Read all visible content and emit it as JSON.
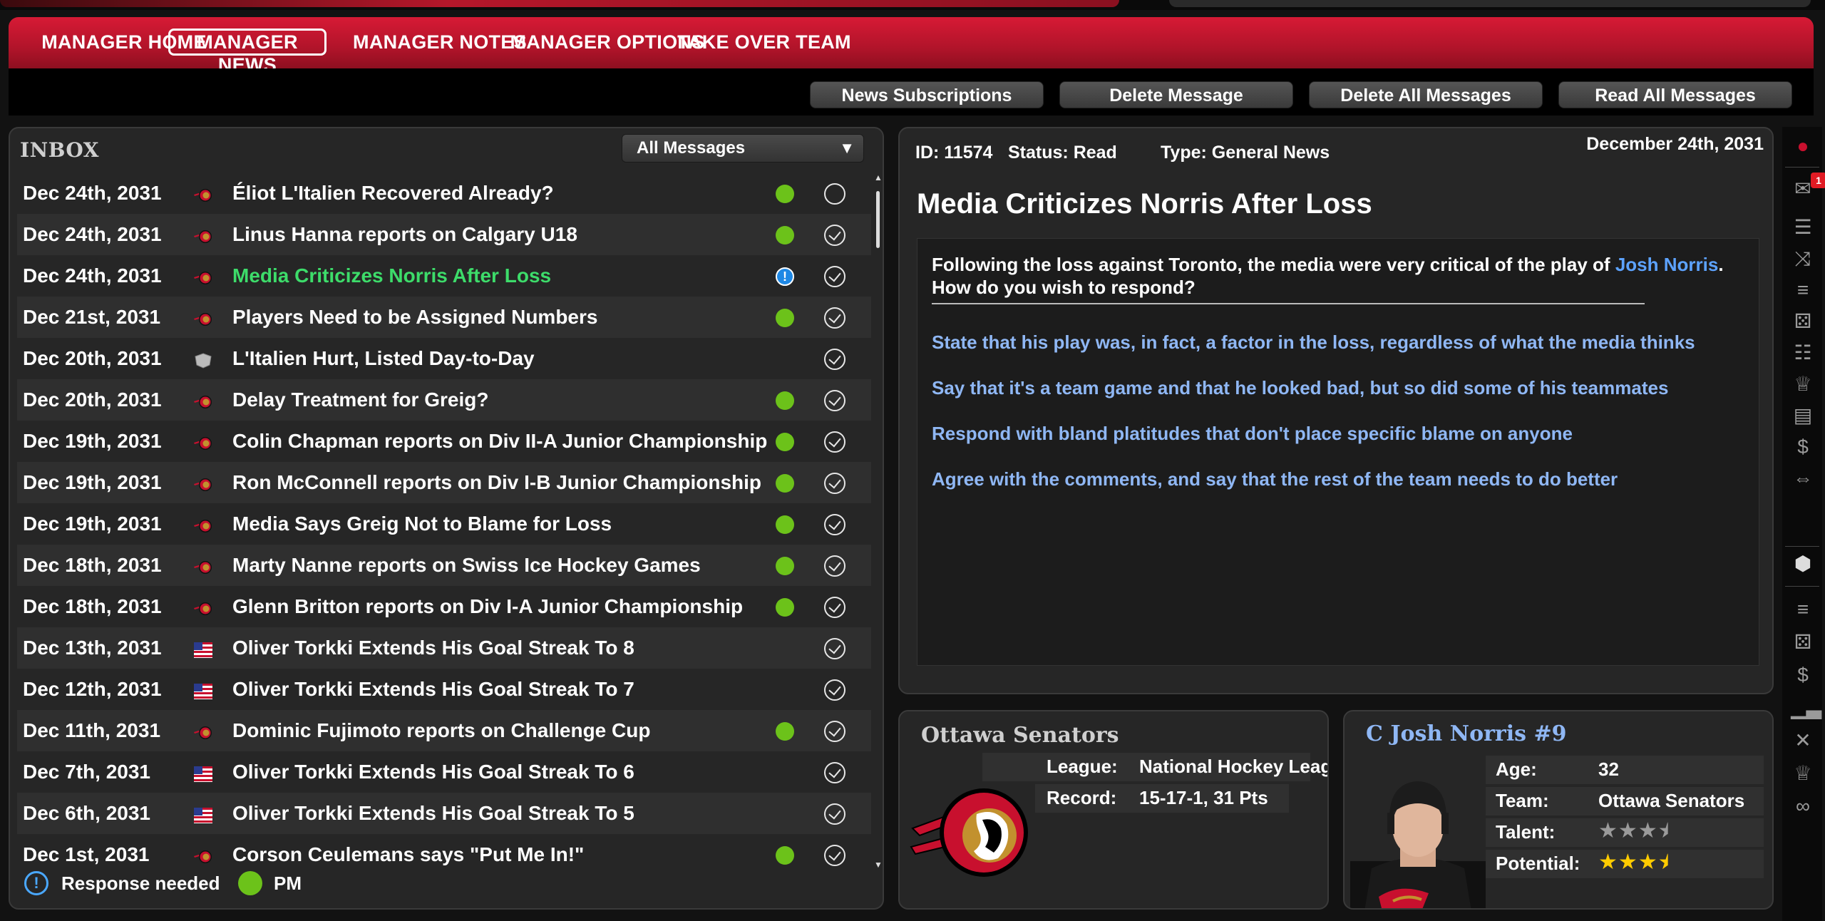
{
  "nav": {
    "items": [
      {
        "label": "MANAGER HOME"
      },
      {
        "label": "MANAGER NEWS"
      },
      {
        "label": "MANAGER NOTES"
      },
      {
        "label": "MANAGER OPTIONS"
      },
      {
        "label": "TAKE OVER TEAM"
      }
    ],
    "active_index": 1
  },
  "toolbar": {
    "news_subscriptions": "News Subscriptions",
    "delete_message": "Delete Message",
    "delete_all": "Delete All Messages",
    "read_all": "Read All Messages"
  },
  "inbox": {
    "title": "INBOX",
    "filter": "All Messages",
    "rows": [
      {
        "date": "Dec 24th, 2031",
        "subject": "Éliot L'Italien Recovered Already?",
        "icon": "senators-logo-icon",
        "status": "pm",
        "read": false
      },
      {
        "date": "Dec 24th, 2031",
        "subject": "Linus Hanna reports on Calgary U18",
        "icon": "senators-logo-icon",
        "status": "pm",
        "read": true
      },
      {
        "date": "Dec 24th, 2031",
        "subject": "Media Criticizes Norris After Loss",
        "icon": "senators-logo-icon",
        "status": "response",
        "read": true,
        "selected": true
      },
      {
        "date": "Dec 21st, 2031",
        "subject": "Players Need to be Assigned Numbers",
        "icon": "senators-logo-icon",
        "status": "pm",
        "read": true
      },
      {
        "date": "Dec 20th, 2031",
        "subject": "L'Italien Hurt, Listed Day-to-Day",
        "icon": "nhl-logo-icon",
        "status": "",
        "read": true
      },
      {
        "date": "Dec 20th, 2031",
        "subject": "Delay Treatment for Greig?",
        "icon": "senators-logo-icon",
        "status": "pm",
        "read": true
      },
      {
        "date": "Dec 19th, 2031",
        "subject": "Colin Chapman reports on Div II-A Junior Championship",
        "icon": "senators-logo-icon",
        "status": "pm",
        "read": true
      },
      {
        "date": "Dec 19th, 2031",
        "subject": "Ron McConnell reports on Div I-B Junior Championship",
        "icon": "senators-logo-icon",
        "status": "pm",
        "read": true
      },
      {
        "date": "Dec 19th, 2031",
        "subject": "Media Says Greig Not to Blame for Loss",
        "icon": "senators-logo-icon",
        "status": "pm",
        "read": true
      },
      {
        "date": "Dec 18th, 2031",
        "subject": "Marty Nanne reports on Swiss Ice Hockey Games",
        "icon": "senators-logo-icon",
        "status": "pm",
        "read": true
      },
      {
        "date": "Dec 18th, 2031",
        "subject": "Glenn Britton reports on Div I-A Junior Championship",
        "icon": "senators-logo-icon",
        "status": "pm",
        "read": true
      },
      {
        "date": "Dec 13th, 2031",
        "subject": "Oliver Torkki Extends His Goal Streak To 8",
        "icon": "usa-flag-icon",
        "status": "",
        "read": true
      },
      {
        "date": "Dec 12th, 2031",
        "subject": "Oliver Torkki Extends His Goal Streak To 7",
        "icon": "usa-flag-icon",
        "status": "",
        "read": true
      },
      {
        "date": "Dec 11th, 2031",
        "subject": "Dominic Fujimoto reports on Challenge Cup",
        "icon": "senators-logo-icon",
        "status": "pm",
        "read": true
      },
      {
        "date": "Dec 7th, 2031",
        "subject": "Oliver Torkki Extends His Goal Streak To 6",
        "icon": "usa-flag-icon",
        "status": "",
        "read": true
      },
      {
        "date": "Dec 6th, 2031",
        "subject": "Oliver Torkki Extends His Goal Streak To 5",
        "icon": "usa-flag-icon",
        "status": "",
        "read": true
      },
      {
        "date": "Dec 1st, 2031",
        "subject": "Corson Ceulemans says \"Put Me In!\"",
        "icon": "senators-logo-icon",
        "status": "pm",
        "read": true
      }
    ],
    "legend": {
      "response": "Response needed",
      "pm": "PM"
    }
  },
  "message": {
    "id_label": "ID:",
    "id_value": "11574",
    "status_label": "Status:",
    "status_value": "Read",
    "type_label": "Type:",
    "type_value": "General News",
    "date": "December 24th, 2031",
    "title": "Media Criticizes Norris After Loss",
    "body_before": "Following the loss against Toronto, the media were very critical of the play of ",
    "body_link": "Josh Norris",
    "body_after": ". How do you wish to respond?",
    "options": [
      "State that his play was, in fact, a factor in the loss, regardless of what the media thinks",
      "Say that it's a team game and that he looked bad, but so did some of his teammates",
      "Respond with bland platitudes that don't place specific blame on anyone",
      "Agree with the comments, and say that the rest of the team needs to do better"
    ]
  },
  "team": {
    "name": "Ottawa Senators",
    "league_label": "League:",
    "league_value": "National Hockey Leag",
    "record_label": "Record:",
    "record_value": "15-17-1, 31 Pts"
  },
  "player": {
    "name": "C Josh Norris #9",
    "age_label": "Age:",
    "age_value": "32",
    "team_label": "Team:",
    "team_value": "Ottawa Senators",
    "talent_label": "Talent:",
    "talent_stars": 3.5,
    "potential_label": "Potential:",
    "potential_stars": 3.5
  },
  "sidebar": {
    "notification_count": "1"
  },
  "colors": {
    "nav_red": "#c8182f",
    "pm_green": "#6cc21a",
    "response_blue": "#1e88e5",
    "selected_green": "#3ddc6a",
    "link_blue": "#5da3ff",
    "option_blue": "#8fb7f4",
    "star_gold": "#ffcc00"
  }
}
